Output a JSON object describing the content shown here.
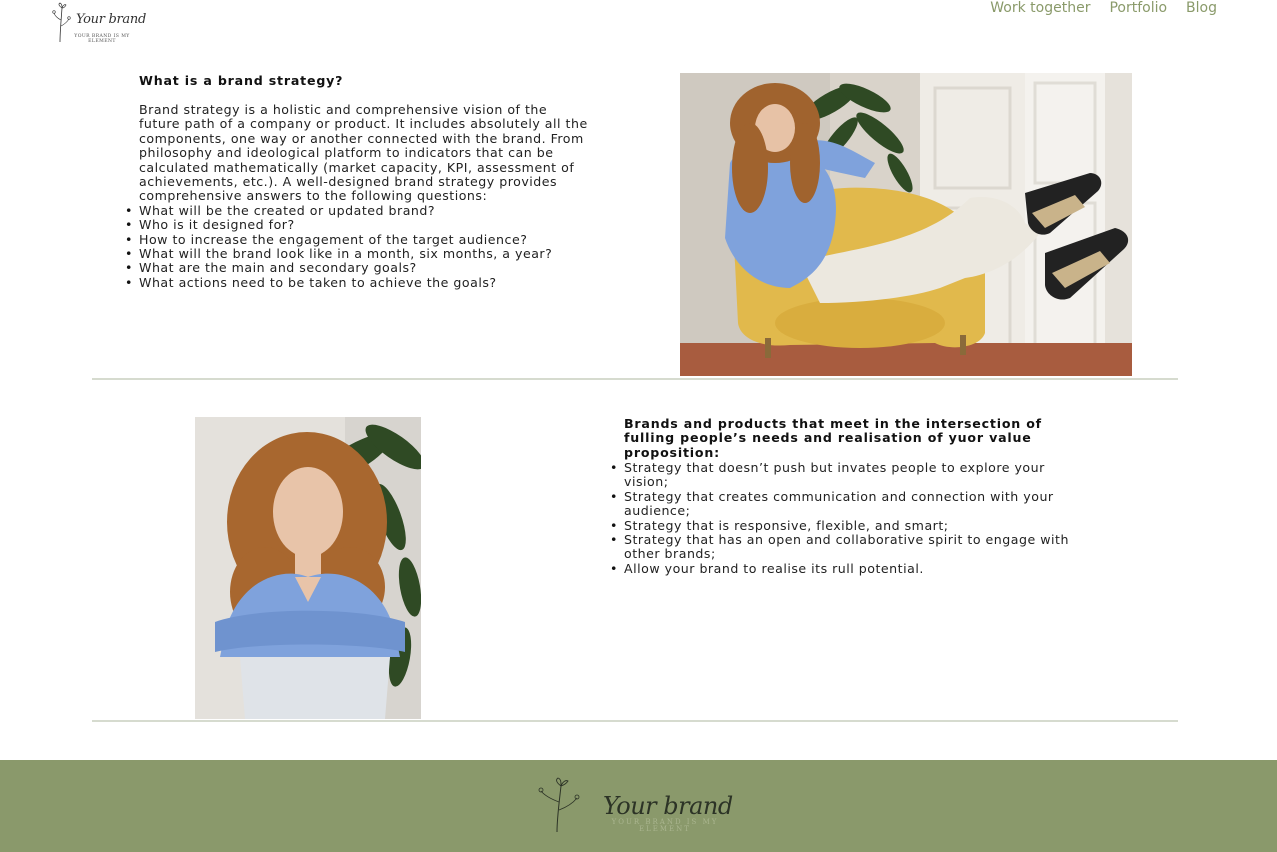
{
  "header": {
    "logo": {
      "script": "Your brand",
      "tagline": "YOUR BRAND IS MY ELEMENT",
      "icon": "flower-sketch-icon"
    },
    "nav": [
      {
        "label": "Work together"
      },
      {
        "label": "Portfolio"
      },
      {
        "label": "Blog"
      }
    ]
  },
  "section1": {
    "heading": "What is a brand strategy?",
    "paragraph": "Brand strategy is a holistic and comprehensive vision of the future path of a company or product. It includes absolutely all the components, one way or another connected with the brand. From philosophy and ideological platform to indicators that can be calculated mathematically (market capacity, KPI, assessment of achievements, etc.). A well-designed brand strategy provides comprehensive answers to the following questions:",
    "questions": [
      "What will be the created or updated brand?",
      "Who is it designed for?",
      "How to increase the engagement of the target audience?",
      "What will the brand look like in a month, six months, a year?",
      "What are the main and secondary goals?",
      "What actions need to be taken to achieve the goals?"
    ]
  },
  "section2": {
    "heading": "Brands and products that meet in the intersection of fulling people’s needs and realisation of yuor value proposition:",
    "points": [
      "Strategy that doesn’t push but invates people to explore your vision;",
      "Strategy that creates communication and connection with your audience;",
      "Strategy that is responsive, flexible, and smart;",
      "Strategy that has an open and collaborative spirit to engage with other brands;",
      "Allow your brand to realise its rull potential."
    ]
  },
  "footer": {
    "logo": {
      "script": "Your brand",
      "tagline": "YOUR BRAND IS MY ELEMENT",
      "icon": "flower-sketch-icon"
    }
  },
  "colors": {
    "accent_green": "#8a996b",
    "nav_text": "#8a9a6a",
    "divider": "#d6dbcf",
    "sweater_blue": "#7fa2dc",
    "chair_yellow": "#e1b94c"
  }
}
